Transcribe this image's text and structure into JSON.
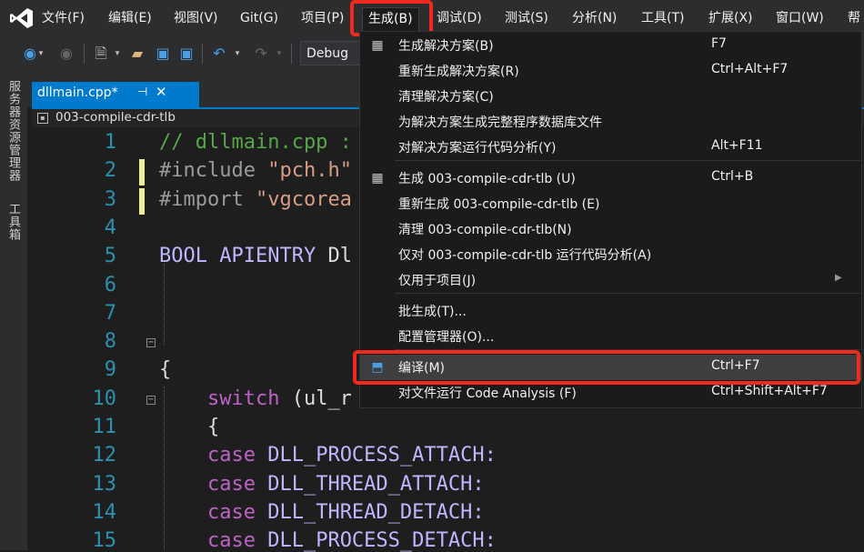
{
  "menubar": {
    "items": [
      {
        "label": "文件(F)"
      },
      {
        "label": "编辑(E)"
      },
      {
        "label": "视图(V)"
      },
      {
        "label": "Git(G)"
      },
      {
        "label": "项目(P)"
      },
      {
        "label": "生成(B)"
      },
      {
        "label": "调试(D)"
      },
      {
        "label": "测试(S)"
      },
      {
        "label": "分析(N)"
      },
      {
        "label": "工具(T)"
      },
      {
        "label": "扩展(X)"
      },
      {
        "label": "窗口(W)"
      },
      {
        "label": "帮"
      }
    ]
  },
  "toolbar": {
    "config": "Debug"
  },
  "side_strip": {
    "tabs": [
      "服务器资源管理器",
      "工具箱"
    ]
  },
  "editor": {
    "tab_title": "dllmain.cpp*",
    "pin": "⊣",
    "close": "✕",
    "nav_project": "003-compile-cdr-tlb",
    "lines": [
      {
        "n": "1",
        "code": [
          {
            "t": "// dllmain.cpp :",
            "c": "c-comment"
          }
        ]
      },
      {
        "n": "2",
        "code": [
          {
            "t": "#include ",
            "c": "c-macro"
          },
          {
            "t": "\"pch.h\"",
            "c": "c-string"
          }
        ]
      },
      {
        "n": "3",
        "code": [
          {
            "t": "#import ",
            "c": "c-macro"
          },
          {
            "t": "\"vgcorea",
            "c": "c-string"
          }
        ]
      },
      {
        "n": "4",
        "code": []
      },
      {
        "n": "5",
        "code": [
          {
            "t": "BOOL ",
            "c": "c-ident"
          },
          {
            "t": "APIENTRY ",
            "c": "c-ident"
          },
          {
            "t": "Dl",
            "c": "c-plain"
          }
        ]
      },
      {
        "n": "6",
        "code": []
      },
      {
        "n": "7",
        "code": []
      },
      {
        "n": "8",
        "code": []
      },
      {
        "n": "9",
        "code": [
          {
            "t": "{",
            "c": "c-plain"
          }
        ]
      },
      {
        "n": "10",
        "code": [
          {
            "t": "    switch ",
            "c": "c-macro2"
          },
          {
            "t": "(ul_r",
            "c": "c-plain"
          }
        ]
      },
      {
        "n": "11",
        "code": [
          {
            "t": "    {",
            "c": "c-plain"
          }
        ]
      },
      {
        "n": "12",
        "code": [
          {
            "t": "    case ",
            "c": "c-macro2"
          },
          {
            "t": "DLL_PROCESS_ATTACH:",
            "c": "c-ident"
          }
        ]
      },
      {
        "n": "13",
        "code": [
          {
            "t": "    case ",
            "c": "c-macro2"
          },
          {
            "t": "DLL_THREAD_ATTACH:",
            "c": "c-ident"
          }
        ]
      },
      {
        "n": "14",
        "code": [
          {
            "t": "    case ",
            "c": "c-macro2"
          },
          {
            "t": "DLL_THREAD_DETACH:",
            "c": "c-ident"
          }
        ]
      },
      {
        "n": "15",
        "code": [
          {
            "t": "    case ",
            "c": "c-macro2"
          },
          {
            "t": "DLL_PROCESS_DETACH:",
            "c": "c-ident"
          }
        ]
      }
    ]
  },
  "build_menu": {
    "items": [
      {
        "label": "生成解决方案(B)",
        "shortcut": "F7",
        "icon": "build-solution-icon"
      },
      {
        "label": "重新生成解决方案(R)",
        "shortcut": "Ctrl+Alt+F7"
      },
      {
        "label": "清理解决方案(C)",
        "shortcut": ""
      },
      {
        "label": "为解决方案生成完整程序数据库文件",
        "shortcut": ""
      },
      {
        "label": "对解决方案运行代码分析(Y)",
        "shortcut": "Alt+F11"
      },
      {
        "label": "生成 003-compile-cdr-tlb (U)",
        "shortcut": "Ctrl+B",
        "icon": "build-project-icon"
      },
      {
        "label": "重新生成 003-compile-cdr-tlb (E)",
        "shortcut": ""
      },
      {
        "label": "清理 003-compile-cdr-tlb(N)",
        "shortcut": ""
      },
      {
        "label": "仅对 003-compile-cdr-tlb 运行代码分析(A)",
        "shortcut": ""
      },
      {
        "label": "仅用于项目(J)",
        "shortcut": "",
        "submenu": true
      },
      {
        "label": "批生成(T)...",
        "shortcut": ""
      },
      {
        "label": "配置管理器(O)...",
        "shortcut": ""
      },
      {
        "label": "编译(M)",
        "shortcut": "Ctrl+F7",
        "icon": "compile-icon",
        "active": true
      },
      {
        "label": "对文件运行 Code Analysis (F)",
        "shortcut": "Ctrl+Shift+Alt+F7"
      }
    ]
  },
  "colors": {
    "accent": "#007acc",
    "highlight_box": "#f02a1e",
    "menu_bg": "#1b1b1c"
  }
}
